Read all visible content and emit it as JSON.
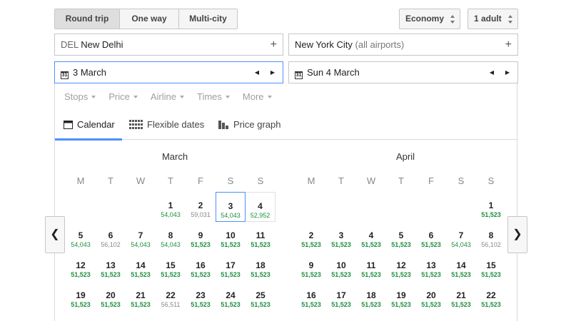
{
  "trip_types": [
    "Round trip",
    "One way",
    "Multi-city"
  ],
  "cabin": "Economy",
  "passengers": "1 adult",
  "origin": {
    "code": "DEL",
    "city": "New Delhi"
  },
  "destination": {
    "city": "New York City",
    "qualifier": "(all airports)"
  },
  "depart_date": "3 March",
  "return_date": "Sun 4 March",
  "calendar_glyph": "31",
  "filters": [
    "Stops",
    "Price",
    "Airline",
    "Times",
    "More"
  ],
  "tabs": {
    "calendar": "Calendar",
    "flexible": "Flexible dates",
    "graph": "Price graph"
  },
  "weekdays": [
    "M",
    "T",
    "W",
    "T",
    "F",
    "S",
    "S"
  ],
  "months": [
    {
      "name": "March",
      "weeks": [
        [
          null,
          null,
          null,
          {
            "day": "1",
            "price": "54,043"
          },
          {
            "day": "2",
            "price": "59,031",
            "grey": true
          },
          {
            "day": "3",
            "price": "54,043",
            "selected": true
          },
          {
            "day": "4",
            "price": "52,952",
            "boxed": true
          }
        ],
        [
          {
            "day": "5",
            "price": "54,043"
          },
          {
            "day": "6",
            "price": "56,102",
            "grey": true
          },
          {
            "day": "7",
            "price": "54,043"
          },
          {
            "day": "8",
            "price": "54,043"
          },
          {
            "day": "9",
            "price": "51,523",
            "bold": true
          },
          {
            "day": "10",
            "price": "51,523",
            "bold": true
          },
          {
            "day": "11",
            "price": "51,523",
            "bold": true
          }
        ],
        [
          {
            "day": "12",
            "price": "51,523",
            "bold": true
          },
          {
            "day": "13",
            "price": "51,523",
            "bold": true
          },
          {
            "day": "14",
            "price": "51,523",
            "bold": true
          },
          {
            "day": "15",
            "price": "51,523",
            "bold": true
          },
          {
            "day": "16",
            "price": "51,523",
            "bold": true
          },
          {
            "day": "17",
            "price": "51,523",
            "bold": true
          },
          {
            "day": "18",
            "price": "51,523",
            "bold": true
          }
        ],
        [
          {
            "day": "19",
            "price": "51,523",
            "bold": true
          },
          {
            "day": "20",
            "price": "51,523",
            "bold": true
          },
          {
            "day": "21",
            "price": "51,523",
            "bold": true
          },
          {
            "day": "22",
            "price": "56,511",
            "grey": true
          },
          {
            "day": "23",
            "price": "51,523",
            "bold": true
          },
          {
            "day": "24",
            "price": "51,523",
            "bold": true
          },
          {
            "day": "25",
            "price": "51,523",
            "bold": true
          }
        ]
      ]
    },
    {
      "name": "April",
      "weeks": [
        [
          null,
          null,
          null,
          null,
          null,
          null,
          {
            "day": "1",
            "price": "51,523",
            "bold": true
          }
        ],
        [
          {
            "day": "2",
            "price": "51,523",
            "bold": true
          },
          {
            "day": "3",
            "price": "51,523",
            "bold": true
          },
          {
            "day": "4",
            "price": "51,523",
            "bold": true
          },
          {
            "day": "5",
            "price": "51,523",
            "bold": true
          },
          {
            "day": "6",
            "price": "51,523",
            "bold": true
          },
          {
            "day": "7",
            "price": "54,043"
          },
          {
            "day": "8",
            "price": "56,102",
            "grey": true
          }
        ],
        [
          {
            "day": "9",
            "price": "51,523",
            "bold": true
          },
          {
            "day": "10",
            "price": "51,523",
            "bold": true
          },
          {
            "day": "11",
            "price": "51,523",
            "bold": true
          },
          {
            "day": "12",
            "price": "51,523",
            "bold": true
          },
          {
            "day": "13",
            "price": "51,523",
            "bold": true
          },
          {
            "day": "14",
            "price": "51,523",
            "bold": true
          },
          {
            "day": "15",
            "price": "51,523",
            "bold": true
          }
        ],
        [
          {
            "day": "16",
            "price": "51,523",
            "bold": true
          },
          {
            "day": "17",
            "price": "51,523",
            "bold": true
          },
          {
            "day": "18",
            "price": "51,523",
            "bold": true
          },
          {
            "day": "19",
            "price": "51,523",
            "bold": true
          },
          {
            "day": "20",
            "price": "51,523",
            "bold": true
          },
          {
            "day": "21",
            "price": "51,523",
            "bold": true
          },
          {
            "day": "22",
            "price": "51,523",
            "bold": true
          }
        ]
      ]
    }
  ],
  "colors": {
    "accent": "#4d90fe",
    "price": "#1e8e3e",
    "price_high": "#888888"
  }
}
